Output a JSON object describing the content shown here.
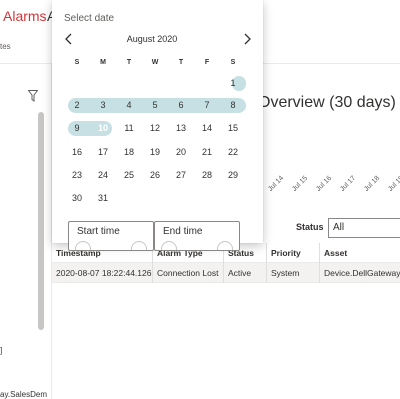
{
  "nav": {
    "alarms": "Alarms",
    "second_tab_partial": "A"
  },
  "toolbar": {
    "partial_text": "tes"
  },
  "sidebar": {
    "bracket_text": "]",
    "device_partial": "ay.SalesDem"
  },
  "overview": {
    "title": "Overview (30 days)",
    "axis_ticks": [
      "Jul 14",
      "Jul 15",
      "Jul 16",
      "Jul 17",
      "Jul 18",
      "Jul 19"
    ]
  },
  "filters": {
    "status_label": "Status",
    "status_value": "All"
  },
  "grid": {
    "columns": [
      "Timestamp",
      "Alarm Type",
      "Status",
      "Priority",
      "Asset"
    ],
    "rows": [
      [
        "2020-08-07 18:22:44.126",
        "Connection Lost",
        "Active",
        "System",
        "Device.DellGateway.V"
      ]
    ]
  },
  "datepicker": {
    "title": "Select date",
    "month": "August 2020",
    "weekdays": [
      "S",
      "M",
      "T",
      "W",
      "T",
      "F",
      "S"
    ],
    "days": [
      [
        "",
        "",
        "",
        "",
        "",
        "",
        "1"
      ],
      [
        "2",
        "3",
        "4",
        "5",
        "6",
        "7",
        "8"
      ],
      [
        "9",
        "10",
        "11",
        "12",
        "13",
        "14",
        "15"
      ],
      [
        "16",
        "17",
        "18",
        "19",
        "20",
        "21",
        "22"
      ],
      [
        "23",
        "24",
        "25",
        "26",
        "27",
        "28",
        "29"
      ],
      [
        "30",
        "31",
        "",
        "",
        "",
        "",
        ""
      ]
    ],
    "selected_day": "10",
    "start_time_label": "Start time",
    "end_time_label": "End time"
  },
  "colors": {
    "accent": "#0e7a8a",
    "range": "#c7e0e4",
    "alarm_red": "#d13438"
  }
}
